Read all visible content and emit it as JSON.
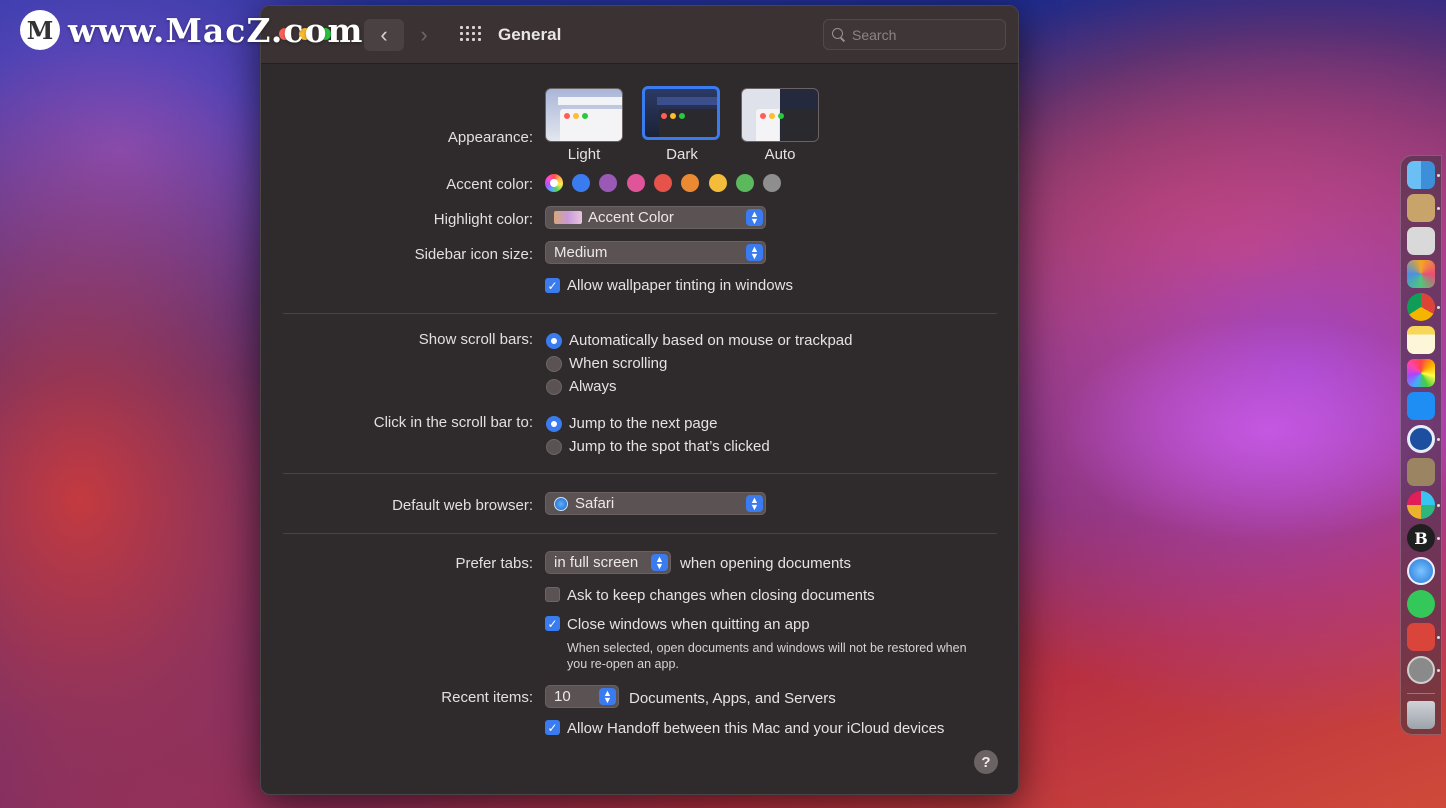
{
  "watermark": {
    "logo_letter": "M",
    "text": "www.MacZ.com"
  },
  "window": {
    "title": "General",
    "nav": {
      "back": "‹",
      "forward": "›"
    },
    "search": {
      "placeholder": "Search"
    }
  },
  "appearance": {
    "label": "Appearance:",
    "options": [
      {
        "name": "Light",
        "selected": false
      },
      {
        "name": "Dark",
        "selected": true
      },
      {
        "name": "Auto",
        "selected": false
      }
    ]
  },
  "accent_color": {
    "label": "Accent color:",
    "colors": [
      "multicolor",
      "#3a7bf0",
      "#9b59b6",
      "#e0559a",
      "#e5534b",
      "#ec8a34",
      "#f3bc3a",
      "#5cb85c",
      "#8e8e8e"
    ]
  },
  "highlight_color": {
    "label": "Highlight color:",
    "value": "Accent Color"
  },
  "sidebar_icon_size": {
    "label": "Sidebar icon size:",
    "value": "Medium"
  },
  "wallpaper_tinting": {
    "label": "Allow wallpaper tinting in windows",
    "checked": true
  },
  "scroll_bars": {
    "label": "Show scroll bars:",
    "options": [
      {
        "text": "Automatically based on mouse or trackpad",
        "selected": true
      },
      {
        "text": "When scrolling",
        "selected": false
      },
      {
        "text": "Always",
        "selected": false
      }
    ]
  },
  "click_scroll": {
    "label": "Click in the scroll bar to:",
    "options": [
      {
        "text": "Jump to the next page",
        "selected": true
      },
      {
        "text": "Jump to the spot that’s clicked",
        "selected": false
      }
    ]
  },
  "default_browser": {
    "label": "Default web browser:",
    "value": "Safari"
  },
  "prefer_tabs": {
    "label": "Prefer tabs:",
    "value": "in full screen",
    "suffix": "when opening documents"
  },
  "ask_keep_changes": {
    "label": "Ask to keep changes when closing documents",
    "checked": false
  },
  "close_windows": {
    "label": "Close windows when quitting an app",
    "checked": true,
    "note": "When selected, open documents and windows will not be restored when you re-open an app."
  },
  "recent_items": {
    "label": "Recent items:",
    "value": "10",
    "suffix": "Documents, Apps, and Servers"
  },
  "handoff": {
    "label": "Allow Handoff between this Mac and your iCloud devices",
    "checked": true
  },
  "help": {
    "label": "?"
  },
  "check_glyph": "✓",
  "stepper_up": "▲",
  "stepper_down": "▼",
  "dock": {
    "apps": [
      "finder-icon",
      "preview-icon",
      "script-editor-icon",
      "launchpad-icon",
      "chrome-icon",
      "notes-icon",
      "photos-icon",
      "app-store-icon",
      "1password-icon",
      "archive-icon",
      "slack-icon",
      "bbedit-icon",
      "safari-icon",
      "messages-icon",
      "photo-booth-icon",
      "system-preferences-icon",
      "trash-icon"
    ],
    "bbedit_letter": "B"
  }
}
